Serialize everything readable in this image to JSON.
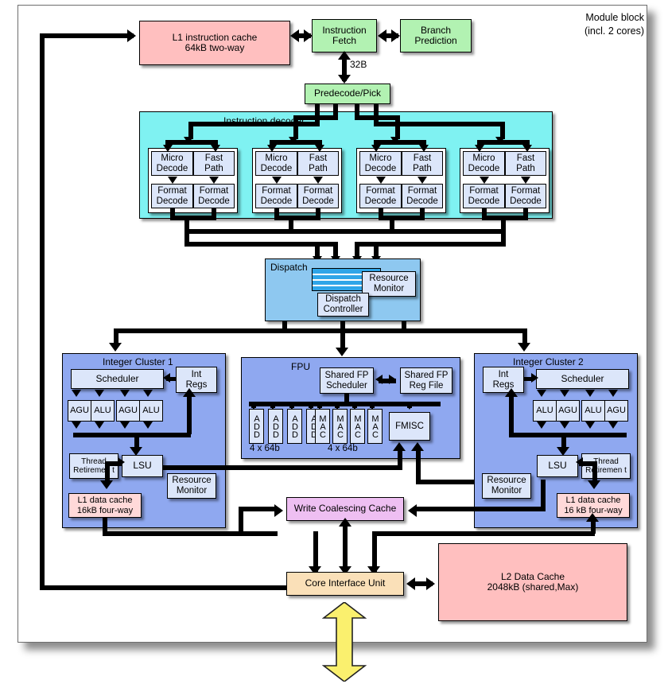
{
  "title": "Module block\n(incl. 2 cores)",
  "frontend": {
    "l1i": "L1 instruction cache\n64kB two-way",
    "fetch": "Instruction\nFetch",
    "branch": "Branch\nPrediction",
    "bus_label": "32B",
    "predecode": "Predecode/Pick"
  },
  "decoder": {
    "label": "Instruction decoder",
    "groups": [
      {
        "micro": "Micro\nDecode",
        "fast": "Fast\nPath",
        "fmt_l": "Format\nDecode",
        "fmt_r": "Format\nDecode"
      },
      {
        "micro": "Micro\nDecode",
        "fast": "Fast\nPath",
        "fmt_l": "Format\nDecode",
        "fmt_r": "Format\nDecode"
      },
      {
        "micro": "Micro\nDecode",
        "fast": "Fast\nPath",
        "fmt_l": "Format\nDecode",
        "fmt_r": "Format\nDecode"
      },
      {
        "micro": "Micro\nDecode",
        "fast": "Fast\nPath",
        "fmt_l": "Format\nDecode",
        "fmt_r": "Format\nDecode"
      }
    ]
  },
  "dispatch": {
    "label": "Dispatch",
    "controller": "Dispatch\nController",
    "resource_monitor": "Resource\nMonitor",
    "queue_rows": 4
  },
  "cluster1": {
    "label": "Integer Cluster 1",
    "scheduler": "Scheduler",
    "int_regs": "Int\nRegs",
    "units": [
      "AGU",
      "ALU",
      "AGU",
      "ALU"
    ],
    "lsu": "LSU",
    "thread_retirement": "Thread\nRetiremen t",
    "resource_monitor": "Resource\nMonitor",
    "l1d": "L1 data cache\n16kB four-way"
  },
  "cluster2": {
    "label": "Integer Cluster 2",
    "scheduler": "Scheduler",
    "int_regs": "Int\nRegs",
    "units": [
      "ALU",
      "AGU",
      "ALU",
      "AGU"
    ],
    "lsu": "LSU",
    "thread_retirement": "Thread\nRetiremen t",
    "resource_monitor": "Resource\nMonitor",
    "l1d": "L1 data cache\n16 kB four-way"
  },
  "fpu": {
    "label": "FPU",
    "scheduler": "Shared FP\nScheduler",
    "regfile": "Shared FP\nReg File",
    "add_units": [
      "ADD",
      "ADD",
      "ADD",
      "ADD"
    ],
    "mac_units": [
      "MAC",
      "MAC",
      "MAC",
      "MAC"
    ],
    "fmisc": "FMISC",
    "add_width": "4 x 64b",
    "mac_width": "4 x 64b"
  },
  "bottom": {
    "wcc": "Write Coalescing Cache",
    "ciu": "Core Interface Unit",
    "l2": "L2 Data Cache\n2048kB (shared,Max)"
  },
  "colors": {
    "cache_pink": "#FFBFBF",
    "frontend_green": "#B2F2B2",
    "decoder_cyan": "#7FF2F2",
    "dispatch_blue": "#8EC8F0",
    "cluster_indigo": "#8FA8F0",
    "inner_pale": "#DCE6FA",
    "wcc_magenta": "#EEBFF2",
    "ciu_peach": "#FAE0B8",
    "queue_blue": "#2FA5E8",
    "external_arrow_yellow": "#FAF06E"
  }
}
